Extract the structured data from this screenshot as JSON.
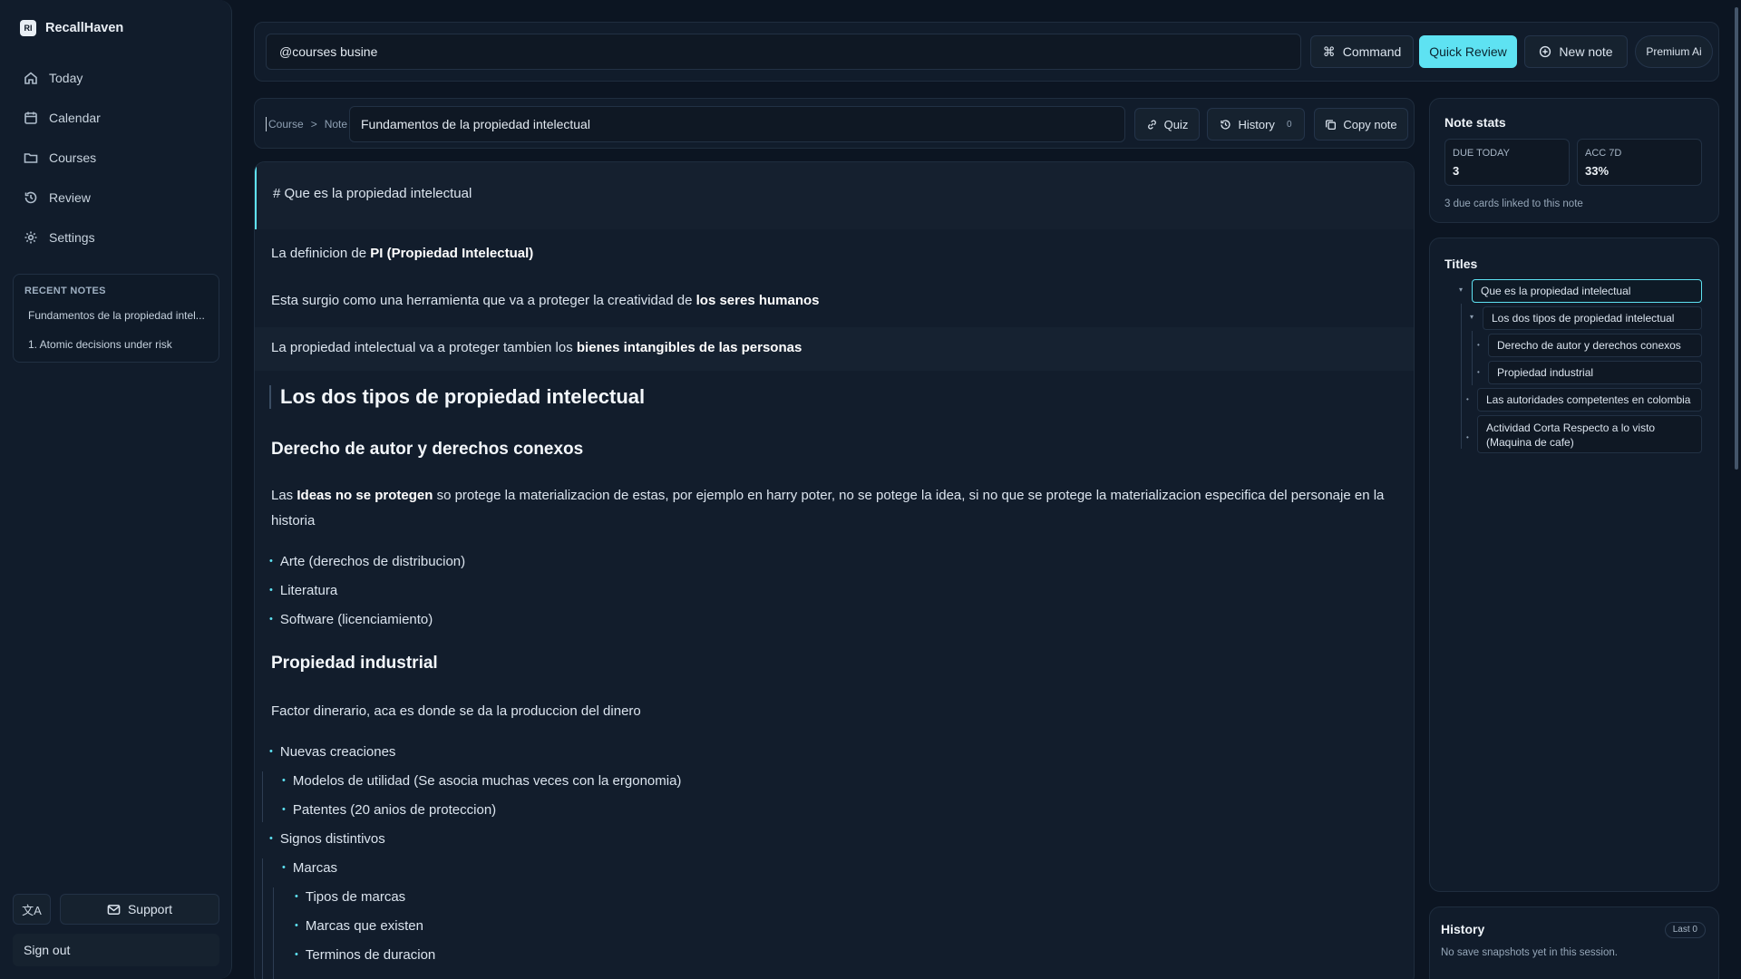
{
  "app": {
    "logo": "RI",
    "name": "RecallHaven"
  },
  "nav": [
    {
      "label": "Today",
      "icon": "home-icon"
    },
    {
      "label": "Calendar",
      "icon": "calendar-icon"
    },
    {
      "label": "Courses",
      "icon": "folder-icon"
    },
    {
      "label": "Review",
      "icon": "history-icon"
    },
    {
      "label": "Settings",
      "icon": "gear-icon"
    }
  ],
  "recent": {
    "title": "RECENT NOTES",
    "items": [
      "Fundamentos de la propiedad intel...",
      "1. Atomic decisions under risk"
    ]
  },
  "sidebar_footer": {
    "lang_icon": "文A",
    "support": "Support",
    "signout": "Sign out"
  },
  "topbar": {
    "search_value": "@courses busine",
    "command": "Command",
    "quick_review": "Quick Review",
    "new_note": "New note",
    "premium": "Premium Ai"
  },
  "editor_head": {
    "crumb_course": "Course",
    "crumb_sep": ">",
    "crumb_note": "Note",
    "title": "Fundamentos de la propiedad intelectual",
    "quiz": "Quiz",
    "history": "History",
    "history_count": "0",
    "copy": "Copy note"
  },
  "doc": {
    "heading_raw": "# Que es la propiedad intelectual",
    "l1_pre": "La definicion de ",
    "l1_bold": "PI (Propiedad Intelectual)",
    "l2_pre": "Esta surgio como una herramienta que va a proteger la creatividad de ",
    "l2_bold": "los seres humanos",
    "l3_pre": "La propiedad intelectual va a proteger tambien los ",
    "l3_bold": "bienes intangibles de las personas",
    "h1": "Los dos tipos de propiedad intelectual",
    "h2a": "Derecho de autor y derechos conexos",
    "p1_pre": "Las ",
    "p1_bold": "Ideas no se protegen",
    "p1_rest": " so protege la materializacion de estas, por ejemplo en harry poter, no se potege la idea, si no que se protege la materializacion especifica del personaje en la historia",
    "b1": "Arte (derechos de distribucion)",
    "b2": "Literatura",
    "b3": "Software (licenciamiento)",
    "h2b": "Propiedad industrial",
    "p2": "Factor dinerario, aca es donde se da la produccion del dinero",
    "b4": "Nuevas creaciones",
    "b4a": "Modelos de utilidad (Se asocia muchas veces con la ergonomia)",
    "b4b": "Patentes (20 anios de proteccion)",
    "b5": "Signos distintivos",
    "b5a": "Marcas",
    "b5a1": "Tipos de marcas",
    "b5a2": "Marcas que existen",
    "b5a3": "Terminos de duracion"
  },
  "stats": {
    "title": "Note stats",
    "due_label": "DUE TODAY",
    "due_value": "3",
    "acc_label": "ACC 7D",
    "acc_value": "33%",
    "note": "3 due cards linked to this note"
  },
  "titles": {
    "title": "Titles",
    "items": [
      "Que es la propiedad intelectual",
      "Los dos tipos de propiedad intelectual",
      "Derecho de autor y derechos conexos",
      "Propiedad industrial",
      "Las autoridades competentes en colombia",
      "Actividad Corta Respecto a lo visto",
      "(Maquina de cafe)"
    ]
  },
  "history_panel": {
    "title": "History",
    "badge": "Last 0",
    "empty": "No save snapshots yet in this session."
  },
  "colors": {
    "accent": "#5ee2f2",
    "bg": "#0c1522",
    "panel": "#111c2b"
  }
}
